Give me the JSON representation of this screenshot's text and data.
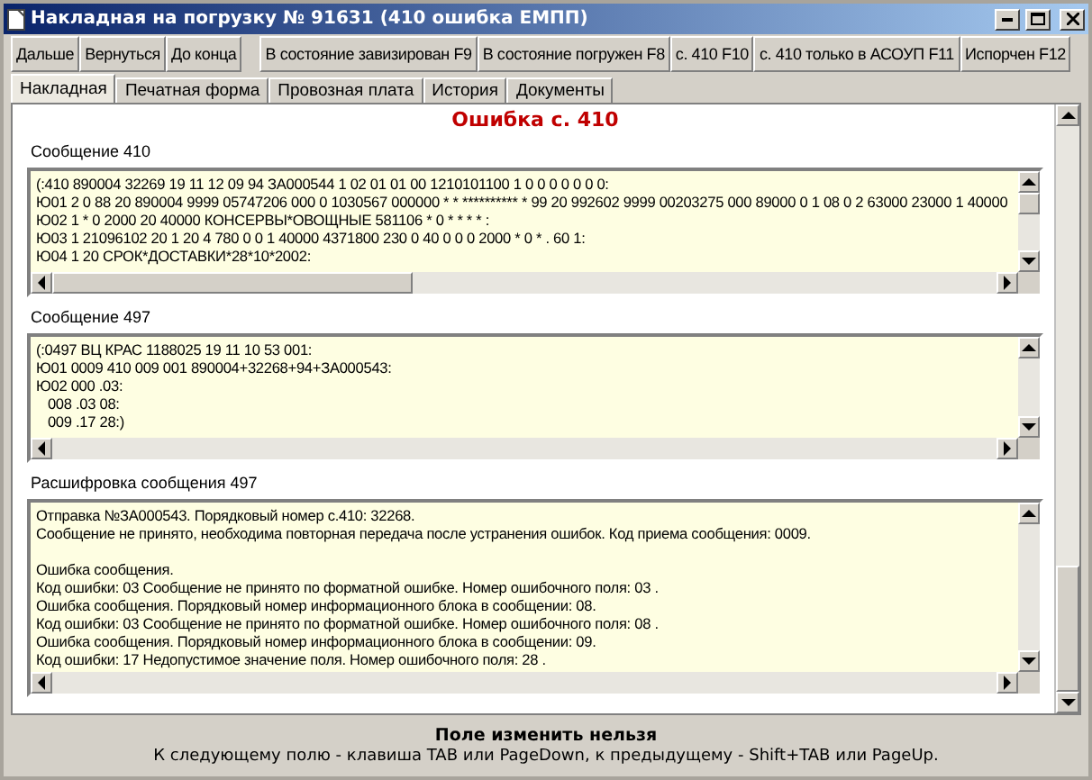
{
  "window": {
    "title": "Накладная на погрузку № 91631 (410 ошибка ЕМПП)"
  },
  "toolbar": {
    "nav_buttons": [
      "Дальше",
      "Вернуться",
      "До конца"
    ],
    "action_buttons": [
      "В состояние завизирован F9",
      "В состояние погружен F8",
      "с. 410 F10",
      "с. 410 только в АСОУП F11",
      "Испорчен F12"
    ]
  },
  "tabs": [
    {
      "label": "Накладная",
      "selected": true
    },
    {
      "label": "Печатная форма",
      "selected": false
    },
    {
      "label": "Провозная плата",
      "selected": false
    },
    {
      "label": "История",
      "selected": false
    },
    {
      "label": "Документы",
      "selected": false
    }
  ],
  "heading": "Ошибка с. 410",
  "sections": [
    {
      "label": "Сообщение 410",
      "lines": [
        "(:410 890004 32269 19 11 12 09 94 ЗА000544 1 02 01 01 00 1210101100 1 0 0 0 0 0 0 0:",
        "Ю01 2 0 88 20 890004 9999 05747206 000 0 1030567 000000 * * ********** * 99 20 992602 9999 00203275 000 89000 0 1 08 0 2 63000 23000 1 40000",
        "Ю02 1 * 0 2000 20 40000 КОНСЕРВЫ*ОВОЩНЫЕ 581106 * 0 * * * * :",
        "Ю03 1 21096102 20 1 20 4 780 0 0 1 40000 4371800 230 0 40 0 0 0 2000 * 0 * . 60 1:",
        "Ю04 1 20 СРОК*ДОСТАВКИ*28*10*2002:"
      ]
    },
    {
      "label": "Сообщение 497",
      "lines": [
        "(:0497 ВЦ КРАС 1188025 19 11 10 53 001:",
        "Ю01 0009 410 009 001 890004+32268+94+ЗА000543:",
        "Ю02 000 .03:",
        "   008 .03 08:",
        "   009 .17 28:)"
      ]
    },
    {
      "label": "Расшифровка сообщения 497",
      "lines": [
        "Отправка №ЗА000543. Порядковый номер с.410: 32268.",
        "Сообщение не принято, необходима повторная передача после устранения ошибок. Код приема сообщения: 0009."
      ],
      "lines_after_gap": [
        "Ошибка сообщения.",
        "Код ошибки: 03 Сообщение не принято по форматной ошибке. Номер ошибочного поля: 03 .",
        "Ошибка сообщения. Порядковый номер информационного блока в сообщении: 08.",
        "Код ошибки: 03 Сообщение не принято по форматной ошибке. Номер ошибочного поля: 08 .",
        "Ошибка сообщения. Порядковый номер информационного блока в сообщении: 09.",
        "Код ошибки: 17 Недопустимое значение поля. Номер ошибочного поля: 28 ."
      ]
    }
  ],
  "status": {
    "title": "Поле изменить нельзя",
    "hint": "К следующему полю - клавиша TAB или PageDown, к предыдущему - Shift+TAB или PageUp."
  }
}
